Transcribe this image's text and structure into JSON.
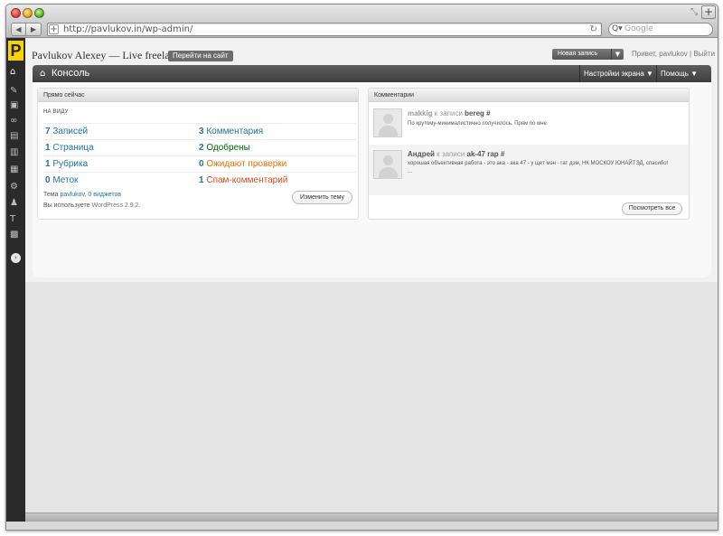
{
  "browser": {
    "url": "http://pavlukov.in/wp-admin/",
    "search_placeholder": "Google",
    "new_tab_symbol": "+",
    "reload_symbol": "↻",
    "add_bookmark_symbol": "+"
  },
  "admin_menu": {
    "logo_letter": "P",
    "icons": [
      "dashboard-icon",
      "posts-icon",
      "media-icon",
      "links-icon",
      "pages-icon",
      "comments-icon",
      "appearance-icon",
      "plugins-icon",
      "users-icon",
      "tools-icon",
      "settings-icon"
    ],
    "collapse_symbol": "›"
  },
  "header": {
    "site_title": "Pavlukov Alexey — Live freelance",
    "visit_site": "Перейти на сайт",
    "new_post": "Новая запись",
    "greeting_prefix": "Привет, ",
    "user": "pavlukov",
    "separator": " | ",
    "logout": "Выйти"
  },
  "page_bar": {
    "title": "Консоль",
    "screen_options": "Настройки экрана ▼",
    "help": "Помощь ▼"
  },
  "right_now": {
    "title": "Прямо сейчас",
    "subheader": "На виду",
    "rows": [
      {
        "left_num": "7",
        "left_label": "Записей",
        "right_num": "3",
        "right_label": "Комментария"
      },
      {
        "left_num": "1",
        "left_label": "Страница",
        "right_num": "2",
        "right_label": "Одобрены"
      },
      {
        "left_num": "1",
        "left_label": "Рубрика",
        "right_num": "0",
        "right_label": "Ожидают проверки"
      },
      {
        "left_num": "0",
        "left_label": "Меток",
        "right_num": "1",
        "right_label": "Спам-комментарий"
      }
    ],
    "theme_prefix": "Тема ",
    "theme_link": "pavlukov, 0 виджетов",
    "wp_version_text": "Вы используете ",
    "wp_version": "WordPress 2.9.2",
    "wp_version_suffix": ".",
    "change_theme": "Изменить тему"
  },
  "comments": {
    "title": "Комментарии",
    "items": [
      {
        "author": "makkig",
        "on": " к записи ",
        "post": "bereg",
        "hash": " #",
        "text": "По крутому-минималистично получилось. Прям по мне."
      },
      {
        "author": "Андрей",
        "on": " к записи ",
        "post": "ak-47 rap",
        "hash": " #",
        "text": "хорошая объективная работа - это ака - ака 47 - у щет мэн - гат дэм, НК МОСКОУ ЮНАЙТЭД, спасибо! ..."
      }
    ],
    "view_all": "Посмотреть все"
  },
  "colors": {
    "link": "#21759b",
    "approved": "#006505",
    "pending": "#e66f00",
    "spam": "#d54e21",
    "header_bar": "#464646",
    "logo": "#f5d400"
  }
}
